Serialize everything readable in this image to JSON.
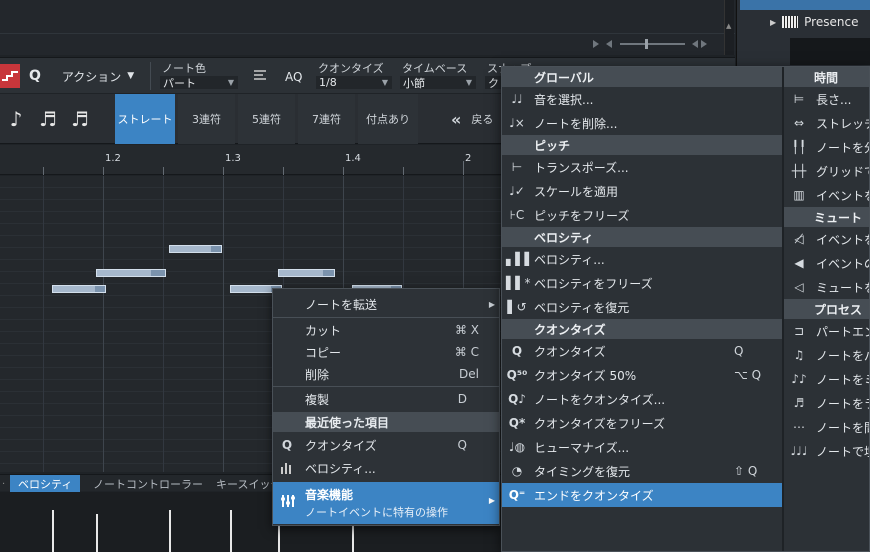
{
  "browser": {
    "presence": "Presence"
  },
  "toolbar": {
    "action": "アクション",
    "note_color_label": "ノート色",
    "note_color_value": "パート",
    "aq": "AQ",
    "quantize_label": "クオンタイズ",
    "quantize_value": "1/8",
    "timebase_label": "タイムベース",
    "timebase_value": "小節",
    "snap_label": "スナップ",
    "snap_value": "ク"
  },
  "grid": {
    "options": [
      "ストレート",
      "3連符",
      "5連符",
      "7連符",
      "付点あり"
    ],
    "back": "戻る"
  },
  "ruler": {
    "labels": [
      "1.2",
      "1.3",
      "1.4",
      "2"
    ]
  },
  "lanes": {
    "tabs": [
      "ベロシティ",
      "ノートコントローラー",
      "キースイッチ"
    ]
  },
  "velocity_heights": [
    42,
    38,
    42,
    42,
    44,
    38
  ],
  "context_menu": {
    "transfer": "ノートを転送",
    "cut": "カット",
    "cut_sc": "⌘ X",
    "copy": "コピー",
    "copy_sc": "⌘ C",
    "delete": "削除",
    "delete_sc": "Del",
    "duplicate": "複製",
    "duplicate_sc": "D",
    "recent_header": "最近使った項目",
    "quantize": "クオンタイズ",
    "quantize_sc": "Q",
    "velocity": "ベロシティ...",
    "music_title": "音楽機能",
    "music_sub": "ノートイベントに特有の操作"
  },
  "submenu_left": {
    "global_header": "グローバル",
    "select_notes": "音を選択...",
    "delete_notes": "ノートを削除...",
    "pitch_header": "ピッチ",
    "transpose": "トランスポーズ...",
    "apply_scale": "スケールを適用",
    "freeze_pitch": "ピッチをフリーズ",
    "velocity_header": "ベロシティ",
    "velocity": "ベロシティ...",
    "freeze_velocity": "ベロシティをフリーズ",
    "restore_velocity": "ベロシティを復元",
    "quantize_header": "クオンタイズ",
    "quantize": "クオンタイズ",
    "quantize_sc": "Q",
    "quantize50": "クオンタイズ 50%",
    "quantize50_sc": "⌥ Q",
    "quantize_notes": "ノートをクオンタイズ...",
    "freeze_quantize": "クオンタイズをフリーズ",
    "humanize": "ヒューマナイズ...",
    "restore_timing": "タイミングを復元",
    "restore_timing_sc": "⇧ Q",
    "quantize_ends": "エンドをクオンタイズ"
  },
  "submenu_right": {
    "time_header": "時間",
    "length": "長さ...",
    "stretch": "ストレッチ",
    "split_notes": "ノートを分",
    "grid": "グリッドで",
    "events": "イベントを",
    "mute_header": "ミュート",
    "mute_events": "イベントを",
    "events2": "イベントの",
    "mute_toggle": "ミュートを",
    "process_header": "プロセス",
    "part_end": "パートエン",
    "note_to_bar": "ノートをパ",
    "note_to_mi": "ノートをミ",
    "note_to_ra": "ノートをラ",
    "note_to_gap": "ノートを間",
    "note_fill": "ノートで埋"
  }
}
